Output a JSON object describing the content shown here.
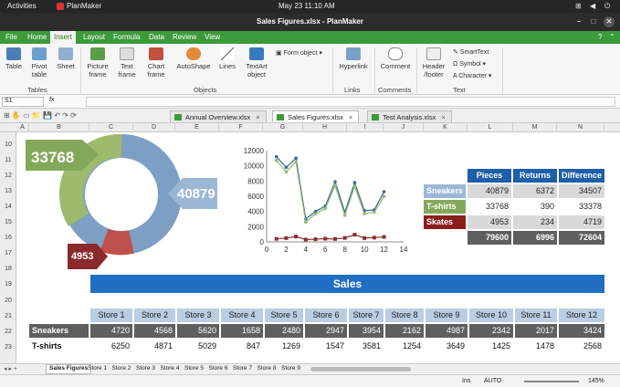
{
  "system": {
    "activities": "Activities",
    "app": "PlanMaker",
    "datetime": "May 23  11:10 AM"
  },
  "window": {
    "title": "Sales Figures.xlsx - PlanMaker"
  },
  "menu": [
    "File",
    "Home",
    "Insert",
    "Layout",
    "Formula",
    "Data",
    "Review",
    "View"
  ],
  "ribbon": {
    "table": "Table",
    "pivot": "Pivot\ntable",
    "sheet": "Sheet",
    "picture": "Picture\nframe",
    "text": "Text\nframe",
    "chart": "Chart\nframe",
    "autoshape": "AutoShape",
    "lines": "Lines",
    "textart": "TextArt\nobject",
    "formobject": "Form object",
    "hyperlink": "Hyperlink",
    "comment": "Comment",
    "header": "Header\n/footer",
    "smarttext": "SmartText",
    "symbol": "Symbol",
    "character": "Character",
    "groups": {
      "tables": "Tables",
      "objects": "Objects",
      "links": "Links",
      "comments": "Comments",
      "text": "Text"
    }
  },
  "formula": {
    "cellref": "S1",
    "fx": "fx"
  },
  "doc_tabs": [
    "Annual Overview.xlsx",
    "Sales Figures.xlsx",
    "Test Analysis.xlsx"
  ],
  "columns": [
    "A",
    "B",
    "C",
    "D",
    "E",
    "F",
    "G",
    "H",
    "I",
    "J",
    "K",
    "L",
    "M",
    "N"
  ],
  "rows": [
    "10",
    "11",
    "12",
    "13",
    "14",
    "15",
    "16",
    "17",
    "18",
    "19",
    "20",
    "21",
    "22",
    "23"
  ],
  "donut": {
    "sneakers": "40879",
    "tshirts": "33768",
    "skates": "4953"
  },
  "summary": {
    "headers": [
      "Pieces",
      "Returns",
      "Difference"
    ],
    "rows": [
      {
        "label": "Sneakers",
        "values": [
          "40879",
          "6372",
          "34507"
        ]
      },
      {
        "label": "T-shirts",
        "values": [
          "33768",
          "390",
          "33378"
        ]
      },
      {
        "label": "Skates",
        "values": [
          "4953",
          "234",
          "4719"
        ]
      }
    ],
    "totals": [
      "79600",
      "6996",
      "72604"
    ]
  },
  "chart_data": {
    "type": "line",
    "x": [
      1,
      2,
      3,
      4,
      5,
      6,
      7,
      8,
      9,
      10,
      11,
      12
    ],
    "xticks": [
      "0",
      "2",
      "4",
      "6",
      "8",
      "10",
      "12",
      "14"
    ],
    "yticks": [
      "0",
      "2000",
      "4000",
      "6000",
      "8000",
      "10000",
      "12000"
    ],
    "xlim": [
      0,
      14
    ],
    "ylim": [
      0,
      12000
    ],
    "series": [
      {
        "name": "Sneakers",
        "values": [
          11200,
          9800,
          11000,
          3000,
          4000,
          4700,
          7900,
          3900,
          7800,
          4100,
          4200,
          6600
        ],
        "color": "#2f6d99"
      },
      {
        "name": "T-shirts",
        "values": [
          10700,
          9200,
          10500,
          2600,
          3700,
          4400,
          7400,
          3500,
          7300,
          3700,
          3900,
          6000
        ],
        "color": "#9ab86a"
      },
      {
        "name": "Skates",
        "values": [
          400,
          500,
          700,
          300,
          350,
          420,
          380,
          520,
          950,
          500,
          560,
          650
        ],
        "color": "#8b3030"
      }
    ],
    "grid": false
  },
  "sales_banner": "Sales",
  "stores": [
    "Store 1",
    "Store 2",
    "Store 3",
    "Store 4",
    "Store 5",
    "Store 6",
    "Store 7",
    "Store 8",
    "Store 9",
    "Store 10",
    "Store 11",
    "Store 12"
  ],
  "store_rows": [
    {
      "label": "Sneakers",
      "values": [
        "4720",
        "4568",
        "5620",
        "1658",
        "2480",
        "2947",
        "3954",
        "2162",
        "4987",
        "2342",
        "2017",
        "3424"
      ]
    },
    {
      "label": "T-shirts",
      "values": [
        "6250",
        "4871",
        "5029",
        "847",
        "1269",
        "1547",
        "3581",
        "1254",
        "3649",
        "1425",
        "1478",
        "2568"
      ]
    }
  ],
  "sheet_tabs": [
    "Sales Figures",
    "Store 1",
    "Store 2",
    "Store 3",
    "Store 4",
    "Store 5",
    "Store 6",
    "Store 7",
    "Store 8",
    "Store 9"
  ],
  "status": {
    "ins": "Ins",
    "auto": "AUTO",
    "zoom": "145%"
  }
}
